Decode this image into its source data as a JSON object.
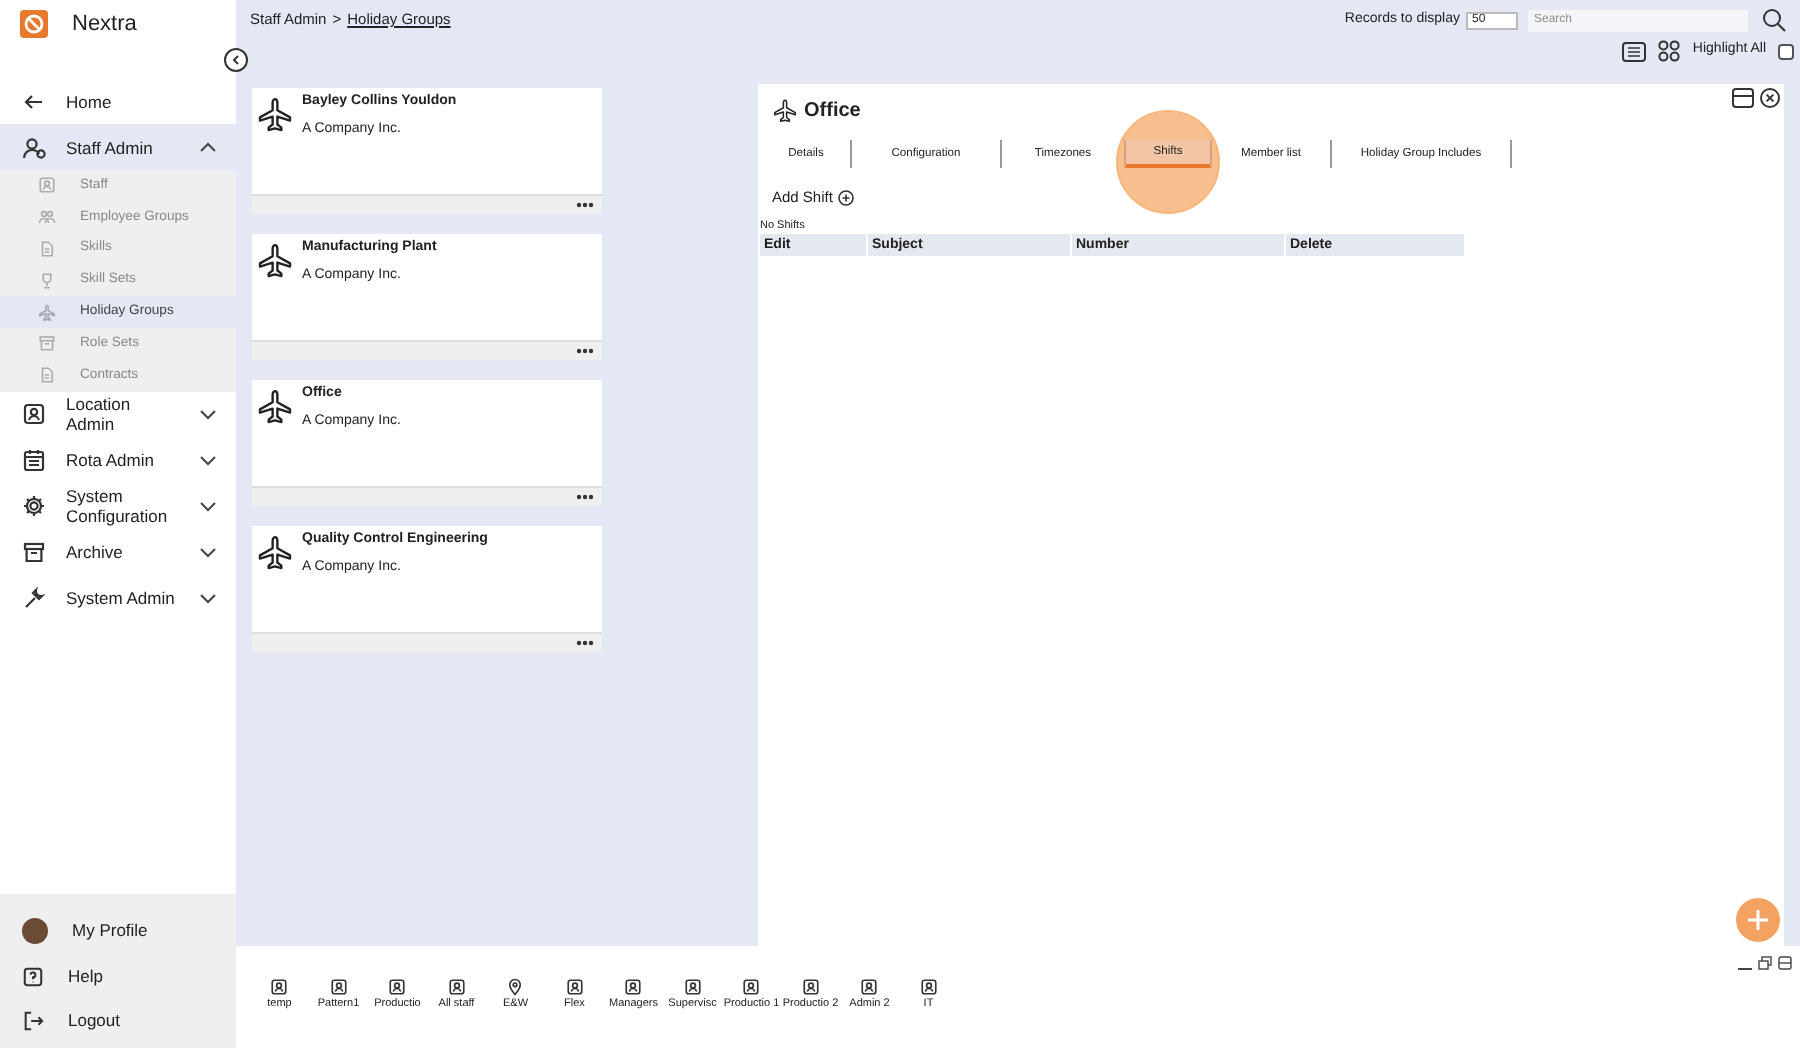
{
  "app": {
    "name": "Nextra"
  },
  "sidebar": {
    "items": [
      {
        "label": "Home",
        "kind": "back",
        "selected": false
      },
      {
        "label": "Staff Admin",
        "kind": "people",
        "selected": true,
        "expanded": true,
        "children": [
          {
            "label": "Staff",
            "kind": "person",
            "selected": false
          },
          {
            "label": "Employee Groups",
            "kind": "group",
            "selected": false
          },
          {
            "label": "Skills",
            "kind": "doc",
            "selected": false
          },
          {
            "label": "Skill Sets",
            "kind": "trophy",
            "selected": false
          },
          {
            "label": "Holiday Groups",
            "kind": "plane",
            "selected": true
          },
          {
            "label": "Role Sets",
            "kind": "box",
            "selected": false
          },
          {
            "label": "Contracts",
            "kind": "doc",
            "selected": false
          }
        ]
      },
      {
        "label": "Location Admin",
        "kind": "person",
        "selected": false,
        "expanded": false
      },
      {
        "label": "Rota Admin",
        "kind": "calendar",
        "selected": false,
        "expanded": false
      },
      {
        "label": "System Configuration",
        "kind": "gear",
        "selected": false,
        "expanded": false
      },
      {
        "label": "Archive",
        "kind": "box",
        "selected": false,
        "expanded": false
      },
      {
        "label": "System Admin",
        "kind": "wrench",
        "selected": false,
        "expanded": false
      }
    ],
    "footer": [
      {
        "label": "My Profile",
        "kind": "avatar"
      },
      {
        "label": "Help",
        "kind": "help"
      },
      {
        "label": "Logout",
        "kind": "logout"
      }
    ]
  },
  "breadcrumb": [
    {
      "label": "Staff Admin",
      "link": false
    },
    {
      "label": ">",
      "link": false
    },
    {
      "label": "Holiday Groups",
      "link": true
    }
  ],
  "toolbar": {
    "records_label": "Records to display",
    "records_value": "50",
    "search_placeholder": "Search",
    "highlight_label": "Highlight All",
    "highlight_checked": false
  },
  "cards": [
    {
      "title": "Bayley Collins Youldon",
      "subtitle": "A Company Inc."
    },
    {
      "title": "Manufacturing Plant",
      "subtitle": "A Company Inc."
    },
    {
      "title": "Office",
      "subtitle": "A Company Inc."
    },
    {
      "title": "Quality Control Engineering",
      "subtitle": "A Company Inc."
    }
  ],
  "detail": {
    "title": "Office",
    "tabs": [
      {
        "label": "Details",
        "selected": false
      },
      {
        "label": "Configuration",
        "selected": false
      },
      {
        "label": "Timezones",
        "selected": false
      },
      {
        "label": "Shifts",
        "selected": true
      },
      {
        "label": "Member list",
        "selected": false
      },
      {
        "label": "Holiday Group Includes",
        "selected": false
      }
    ],
    "add_label": "Add Shift",
    "empty_text": "No Shifts",
    "table": {
      "columns": [
        "Edit",
        "Subject",
        "Number",
        "Delete"
      ]
    }
  },
  "groups": [
    {
      "label": "temp",
      "kind": "person"
    },
    {
      "label": "Pattern1",
      "kind": "person"
    },
    {
      "label": "Productio",
      "kind": "person"
    },
    {
      "label": "All staff",
      "kind": "person"
    },
    {
      "label": "E&W",
      "kind": "location"
    },
    {
      "label": "Flex",
      "kind": "person"
    },
    {
      "label": "Managers",
      "kind": "person"
    },
    {
      "label": "Supervisc",
      "kind": "person"
    },
    {
      "label": "Productio 1",
      "kind": "person"
    },
    {
      "label": "Productio 2",
      "kind": "person"
    },
    {
      "label": "Admin 2",
      "kind": "person"
    },
    {
      "label": "IT",
      "kind": "person"
    }
  ]
}
